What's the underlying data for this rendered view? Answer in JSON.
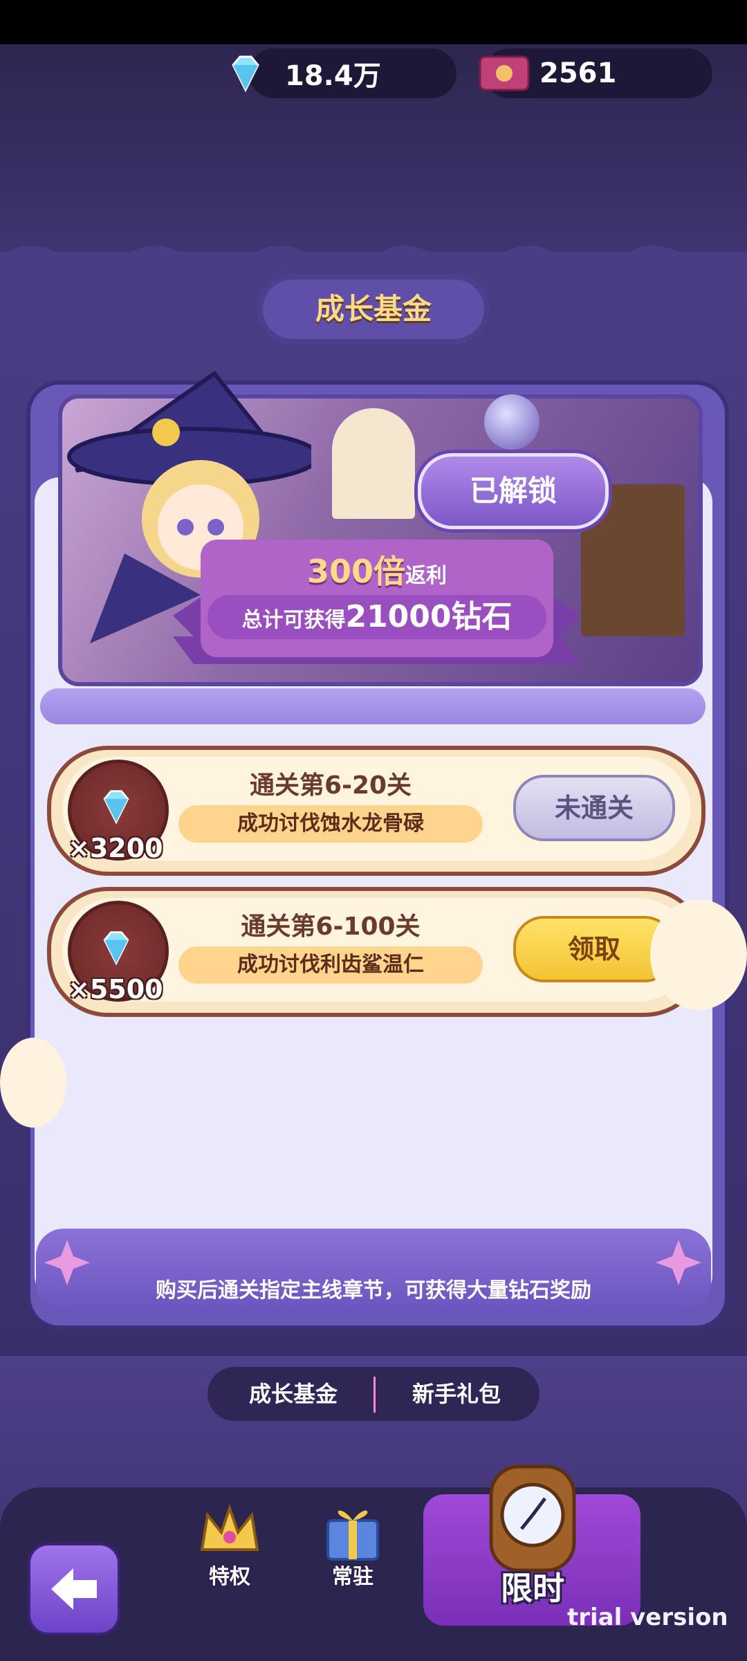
{
  "currency": {
    "diamond_value": "18.4万",
    "ticket_value": "2561"
  },
  "header": {
    "title": "成长基金"
  },
  "banner": {
    "unlocked_label": "已解锁",
    "multiplier_main": "300倍",
    "multiplier_suffix": "返利",
    "total_prefix": "总计可获得",
    "total_amount": "21000",
    "total_suffix": "钻石"
  },
  "rewards": [
    {
      "qty": "×3200",
      "title": "通关第6-20关",
      "desc": "成功讨伐蚀水龙骨碌",
      "button": "未通关",
      "button_state": "locked"
    },
    {
      "qty": "×5500",
      "title": "通关第6-100关",
      "desc": "成功讨伐利齿鲨温仁",
      "button": "领取",
      "button_state": "claimable"
    }
  ],
  "footer": {
    "note": "购买后通关指定主线章节，可获得大量钻石奖励"
  },
  "tabs": [
    {
      "label": "成长基金",
      "active": true
    },
    {
      "label": "新手礼包",
      "active": false
    }
  ],
  "nav": {
    "privilege_label": "特权",
    "permanent_label": "常驻",
    "limited_label": "限时"
  },
  "watermark": "trial version",
  "colors": {
    "accent_purple": "#6a58b8",
    "gold_text": "#ffd98a",
    "claim_yellow": "#f3c332",
    "card_border": "#8c4a3a"
  },
  "icons": {
    "currency_1": "diamond-icon",
    "currency_2": "ticket-icon",
    "reward": "diamond-icon",
    "back": "back-arrow-icon",
    "privilege": "crown-icon",
    "permanent": "gift-box-icon",
    "limited": "clock-icon"
  }
}
